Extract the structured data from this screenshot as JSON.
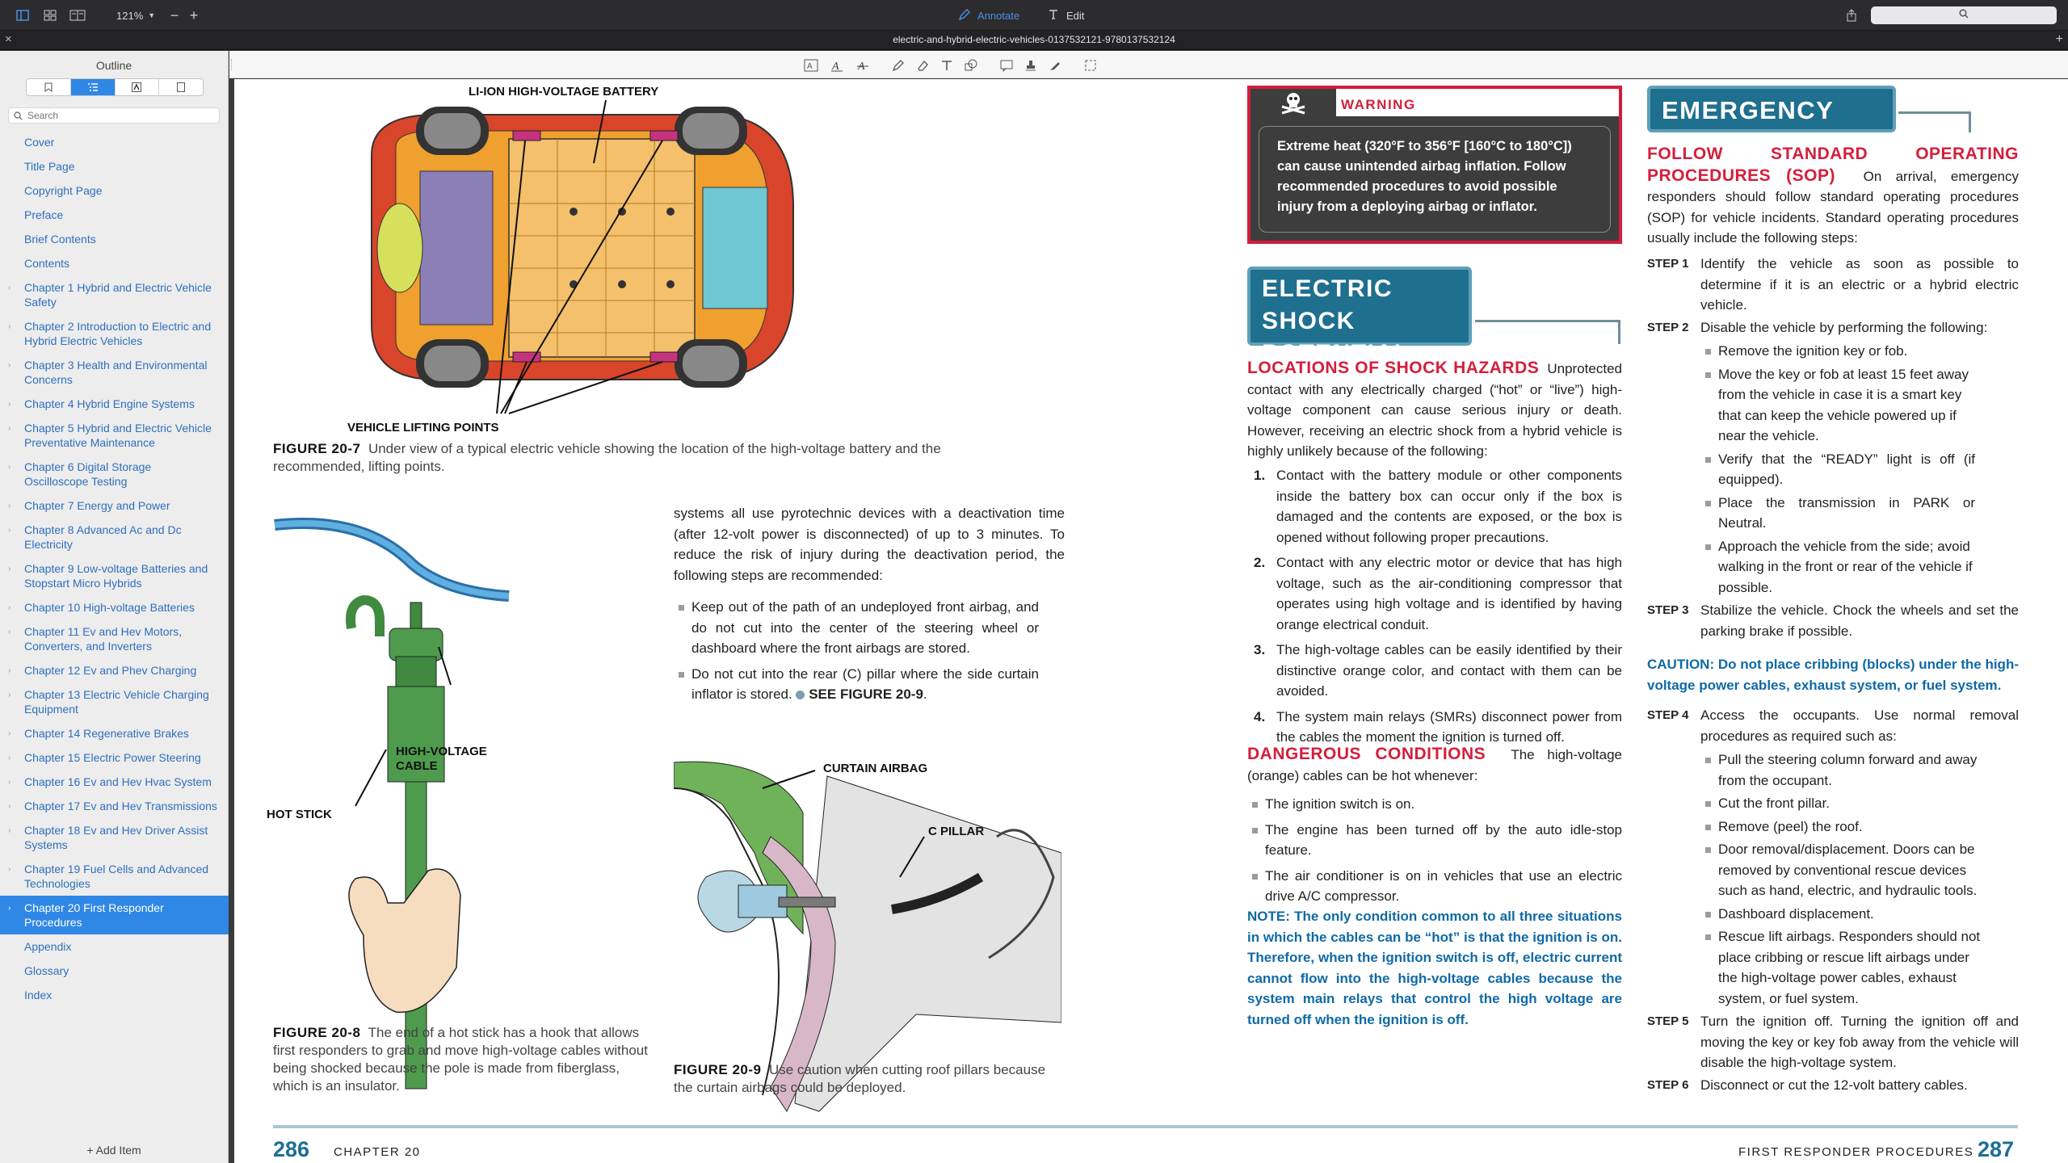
{
  "toolbar": {
    "zoom": "121%",
    "annotate_label": "Annotate",
    "edit_label": "Edit",
    "search_placeholder": ""
  },
  "titlebar": {
    "title": "electric-and-hybrid-electric-vehicles-0137532121-9780137532124"
  },
  "sidebar": {
    "title": "Outline",
    "search_placeholder": "Search",
    "add_item": "Add Item",
    "items": [
      {
        "label": "Cover"
      },
      {
        "label": "Title Page"
      },
      {
        "label": "Copyright Page"
      },
      {
        "label": "Preface"
      },
      {
        "label": "Brief Contents"
      },
      {
        "label": "Contents"
      },
      {
        "label": "Chapter 1 Hybrid and Electric Vehicle Safety"
      },
      {
        "label": "Chapter 2 Introduction to Electric and Hybrid Electric Vehicles"
      },
      {
        "label": "Chapter 3 Health and Environmental Concerns"
      },
      {
        "label": "Chapter 4 Hybrid Engine Systems"
      },
      {
        "label": "Chapter 5 Hybrid and Electric Vehicle Preventative Maintenance"
      },
      {
        "label": "Chapter 6 Digital Storage Oscilloscope Testing"
      },
      {
        "label": "Chapter 7 Energy and Power"
      },
      {
        "label": "Chapter 8 Advanced Ac and Dc Electricity"
      },
      {
        "label": "Chapter 9 Low-voltage Batteries and Stopstart Micro Hybrids"
      },
      {
        "label": "Chapter 10 High-voltage Batteries"
      },
      {
        "label": "Chapter 11 Ev and Hev Motors, Converters, and Inverters"
      },
      {
        "label": "Chapter 12 Ev and Phev Charging"
      },
      {
        "label": "Chapter 13 Electric Vehicle Charging Equipment"
      },
      {
        "label": "Chapter 14 Regenerative Brakes"
      },
      {
        "label": "Chapter 15 Electric Power Steering"
      },
      {
        "label": "Chapter 16 Ev and Hev Hvac System"
      },
      {
        "label": "Chapter 17 Ev and Hev Transmissions"
      },
      {
        "label": "Chapter 18 Ev and Hev Driver Assist Systems"
      },
      {
        "label": "Chapter 19 Fuel Cells and Advanced Technologies"
      },
      {
        "label": "Chapter 20 First Responder Procedures"
      },
      {
        "label": "Appendix"
      },
      {
        "label": "Glossary"
      },
      {
        "label": "Index"
      }
    ]
  },
  "left_page": {
    "fig7": {
      "label_battery": "LI-ION HIGH-VOLTAGE BATTERY",
      "label_lifting": "VEHICLE LIFTING POINTS",
      "fig_num": "FIGURE 20-7",
      "caption": "Under view of a typical electric vehicle showing the location of the high-voltage battery and the recommended, lifting points."
    },
    "fig8": {
      "label_cable": "HIGH-VOLTAGE",
      "label_cable2": "CABLE",
      "label_stick": "HOT STICK",
      "fig_num": "FIGURE 20-8",
      "caption": "The end of a hot stick has a hook that allows first responders to grab and move high-voltage cables without being shocked because the pole is made from fiberglass, which is an insulator."
    },
    "airbag_text": "systems all use pyrotechnic devices with a deactivation time (after 12-volt power is disconnected) of up to 3 minutes. To reduce the risk of injury during the deactivation period, the following steps are recommended:",
    "airbag_bullets": [
      "Keep out of the path of an undeployed front airbag, and do not cut into the center of the steering wheel or dashboard where the front airbags are stored.",
      "Do not cut into the rear (C) pillar where the side curtain inflator is stored."
    ],
    "see_figure": "SEE FIGURE 20-9",
    "fig9": {
      "label_curtain": "CURTAIN AIRBAG",
      "label_pillar": "C PILLAR",
      "fig_num": "FIGURE 20-9",
      "caption": "Use caution when cutting roof pillars because the curtain airbags could be deployed."
    },
    "page_number": "286",
    "running_head": "CHAPTER 20"
  },
  "right_page": {
    "warning": {
      "title": "WARNING",
      "text": "Extreme heat (320°F to 356°F [160°C to 180°C]) can cause unintended airbag inflation. Follow recommended procedures to avoid possible injury from a deploying airbag or inflator."
    },
    "shock_banner_line1": "ELECTRIC SHOCK",
    "shock_banner_line2": "POTENTIAL",
    "locations_head": "LOCATIONS OF SHOCK HAZARDS",
    "locations_text": "Unprotected contact with any electrically charged (“hot” or “live”) high-voltage component can cause serious injury or death. However, receiving an electric shock from a hybrid vehicle is highly unlikely because of the following:",
    "locations_list": [
      "Contact with the battery module or other components inside the battery box can occur only if the box is damaged and the contents are exposed, or the box is opened without following proper precautions.",
      "Contact with any electric motor or device that has high voltage, such as the air-conditioning compressor that operates using high voltage and is identified by having orange electrical conduit.",
      "The high-voltage cables can be easily identified by their distinctive orange color, and contact with them can be avoided.",
      "The system main relays (SMRs) disconnect power from the cables the moment the ignition is turned off."
    ],
    "dangerous_head": "DANGEROUS CONDITIONS",
    "dangerous_text": "The high-voltage (orange) cables can be hot whenever:",
    "dangerous_list": [
      "The ignition switch is on.",
      "The engine has been turned off by the auto idle-stop feature.",
      "The air conditioner is on in vehicles that use an electric drive A/C compressor."
    ],
    "note": "NOTE: The only condition common to all three situations in which the cables can be “hot” is that the ignition is on. Therefore, when the ignition switch is off, electric current cannot flow into the high-voltage cables because the system main relays that control the high voltage are turned off when the ignition is off.",
    "emergency_banner": "EMERGENCY RESPONSE",
    "sop_head": "FOLLOW STANDARD OPERATING PROCEDURES (SOP)",
    "sop_text": "On arrival, emergency responders should follow standard operating procedures (SOP) for vehicle incidents. Standard operating procedures usually include the following steps:",
    "step1_label": "STEP 1",
    "step1": "Identify the vehicle as soon as possible to determine if it is an electric or a hybrid electric vehicle.",
    "step2_label": "STEP 2",
    "step2": "Disable the vehicle by performing the following:",
    "step2_bullets": [
      "Remove the ignition key or fob.",
      "Move the key or fob at least 15 feet away from the vehicle in case it is a smart key that can keep the vehicle powered up if near the vehicle.",
      "Verify that the “READY” light is off (if equipped).",
      "Place the transmission in PARK or Neutral.",
      "Approach the vehicle from the side; avoid walking in the front or rear of the vehicle if possible."
    ],
    "step3_label": "STEP 3",
    "step3": "Stabilize the vehicle. Chock the wheels and set the parking brake if possible.",
    "caution": "CAUTION: Do not place cribbing (blocks) under the high-voltage power cables, exhaust system, or fuel system.",
    "step4_label": "STEP 4",
    "step4": "Access the occupants. Use normal removal procedures as required such as:",
    "step4_bullets": [
      "Pull the steering column forward and away from the occupant.",
      "Cut the front pillar.",
      "Remove (peel) the roof.",
      "Door removal/displacement. Doors can be removed by conventional rescue devices such as hand, electric, and hydraulic tools.",
      "Dashboard displacement.",
      "Rescue lift airbags. Responders should not place cribbing or rescue lift airbags under the high-voltage power cables, exhaust system, or fuel system."
    ],
    "step5_label": "STEP 5",
    "step5": "Turn the ignition off. Turning the ignition off and moving the key or key fob away from the vehicle will disable the high-voltage system.",
    "step6_label": "STEP 6",
    "step6": "Disconnect or cut the 12-volt battery cables.",
    "page_number": "287",
    "running_head": "FIRST RESPONDER PROCEDURES"
  }
}
